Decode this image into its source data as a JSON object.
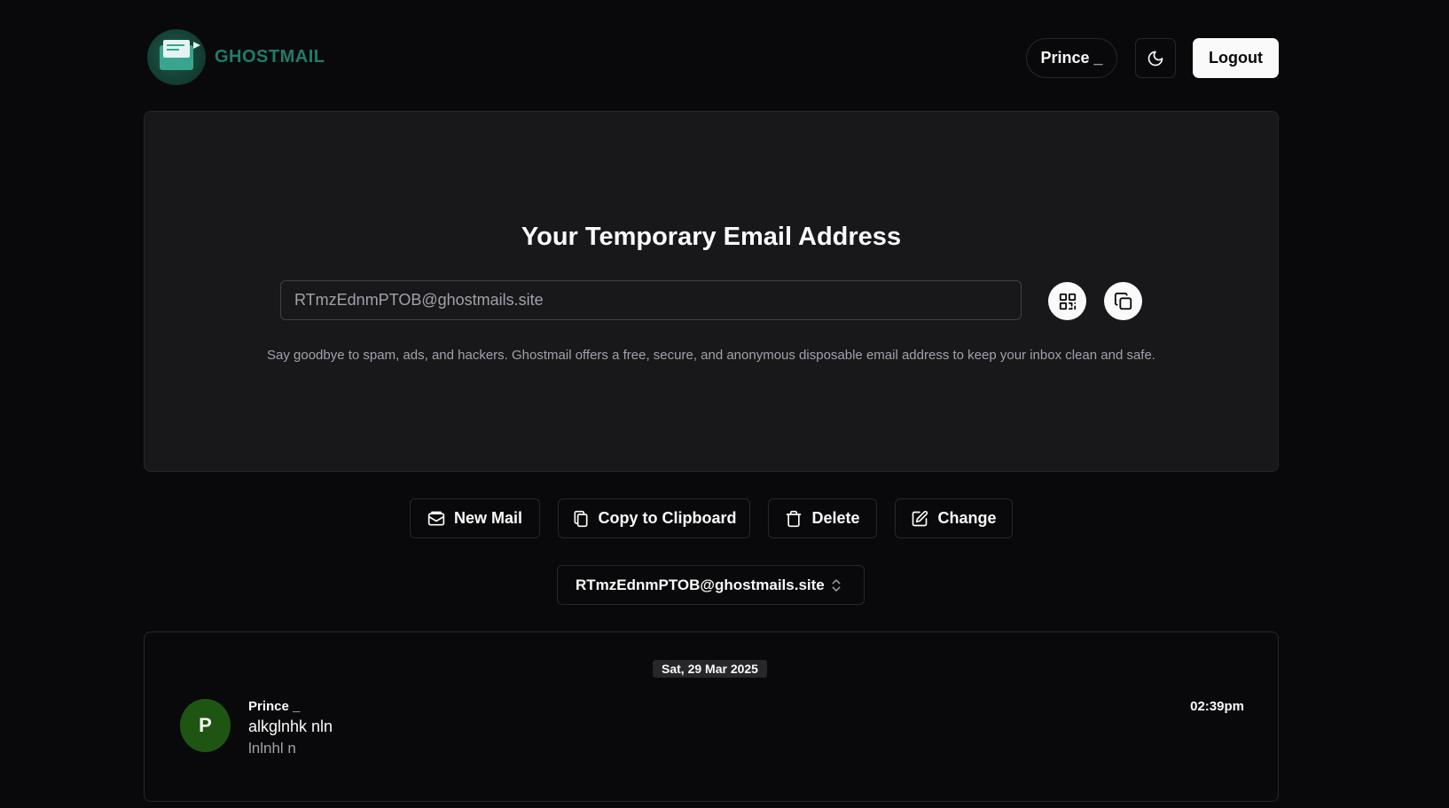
{
  "header": {
    "brand": "GHOSTMAIL",
    "user_label": "Prince _",
    "theme_icon": "moon-icon",
    "logout_label": "Logout"
  },
  "hero": {
    "title": "Your Temporary Email Address",
    "email_value": "RTmzEdnmPTOB@ghostmails.site",
    "description": "Say goodbye to spam, ads, and hackers. Ghostmail offers a free, secure, and anonymous disposable email address to keep your inbox clean and safe.",
    "qr_icon": "qr-code-icon",
    "copy_icon": "copy-icon"
  },
  "actions": {
    "new_mail": "New Mail",
    "copy": "Copy to Clipboard",
    "delete": "Delete",
    "change": "Change"
  },
  "address_select": {
    "selected": "RTmzEdnmPTOB@ghostmails.site"
  },
  "inbox": {
    "date": "Sat, 29 Mar 2025",
    "messages": [
      {
        "avatar_initial": "P",
        "sender": "Prince _",
        "subject": "alkglnhk nln",
        "preview": "lnlnhl n",
        "time": "02:39pm"
      }
    ]
  },
  "colors": {
    "background": "#09090b",
    "card": "#18181b",
    "brand": "#1e7c69",
    "avatar": "#1e5512"
  }
}
